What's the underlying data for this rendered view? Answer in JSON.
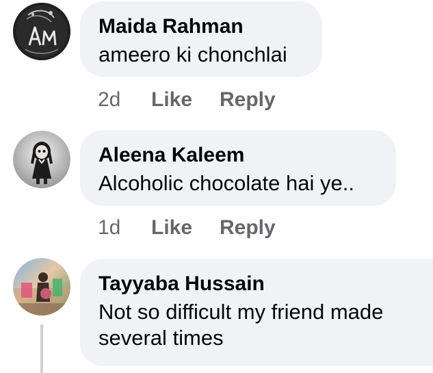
{
  "comments": [
    {
      "author": "Maida Rahman",
      "text": "ameero ki chonchlai",
      "time": "2d",
      "like_label": "Like",
      "reply_label": "Reply",
      "avatar_letters": "AM"
    },
    {
      "author": "Aleena Kaleem",
      "text": "Alcoholic chocolate hai ye..",
      "time": "1d",
      "like_label": "Like",
      "reply_label": "Reply"
    },
    {
      "author": "Tayyaba Hussain",
      "text": "Not so difficult my friend made several times"
    }
  ],
  "colors": {
    "bubble": "#f0f2f5",
    "meta": "#65676b",
    "text": "#050505"
  }
}
